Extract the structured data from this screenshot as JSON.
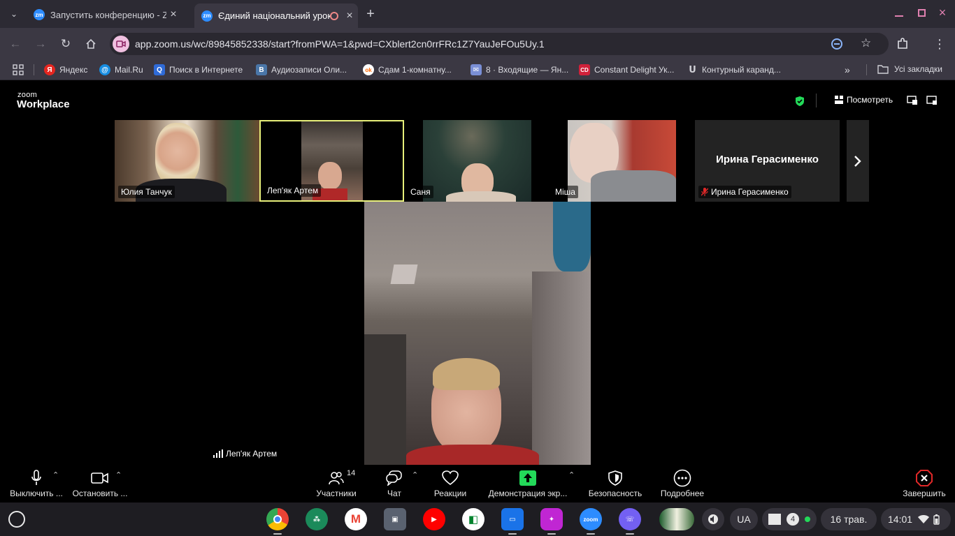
{
  "browser": {
    "tabs": [
      {
        "title": "Запустить конференцию - Zoom",
        "active": false
      },
      {
        "title": "Єдиний національний урок",
        "active": true
      }
    ],
    "url": "app.zoom.us/wc/89845852338/start?fromPWA=1&pwd=CXblert2cn0rrFRc1Z7YauJeFOu5Uy.1",
    "bookmarks": [
      {
        "label": "Яндекс",
        "color": "#e52620",
        "glyph": "Я"
      },
      {
        "label": "Mail.Ru",
        "color": "#168de2",
        "glyph": "@"
      },
      {
        "label": "Поиск в Интернете",
        "color": "#2f6bd8",
        "glyph": "Q"
      },
      {
        "label": "Аудиозаписи Оли...",
        "color": "#4a76a8",
        "glyph": "В"
      },
      {
        "label": "Сдам 1-комнатну...",
        "color": "#ffffff",
        "glyph": "ok"
      },
      {
        "label": "8 · Входящие — Ян...",
        "color": "#7a8fd6",
        "glyph": "✉"
      },
      {
        "label": "Constant Delight Ук...",
        "color": "#d0213a",
        "glyph": "CD"
      },
      {
        "label": "Контурный каранд...",
        "color": "#3b3843",
        "glyph": "Ս"
      }
    ],
    "all_bookmarks_label": "Усі закладки"
  },
  "zoom": {
    "logo_small": "zoom",
    "logo_big": "Workplace",
    "view_label": "Посмотреть",
    "participants": [
      {
        "name": "Юлия Танчук"
      },
      {
        "name": "Леп'як Артем"
      },
      {
        "name": "Саня"
      },
      {
        "name": "Міша"
      },
      {
        "name": "Ирина Герасименко",
        "center_name": "Ирина Герасименко",
        "muted": true
      }
    ],
    "main_speaker": "Леп'як Артем",
    "controls": {
      "mute": "Выключить ...",
      "video": "Остановить ...",
      "participants": "Участники",
      "participants_count": "14",
      "chat": "Чат",
      "reactions": "Реакции",
      "share": "Демонстрация экр...",
      "security": "Безопасность",
      "more": "Подробнее",
      "end": "Завершить"
    }
  },
  "shelf": {
    "lang": "UA",
    "notifications": "4",
    "date": "16 трав.",
    "time": "14:01"
  },
  "colors": {
    "zoom_blue": "#2d8cff",
    "share_green": "#23d959",
    "end_red": "#e02828",
    "active_border": "#e8f07a"
  }
}
